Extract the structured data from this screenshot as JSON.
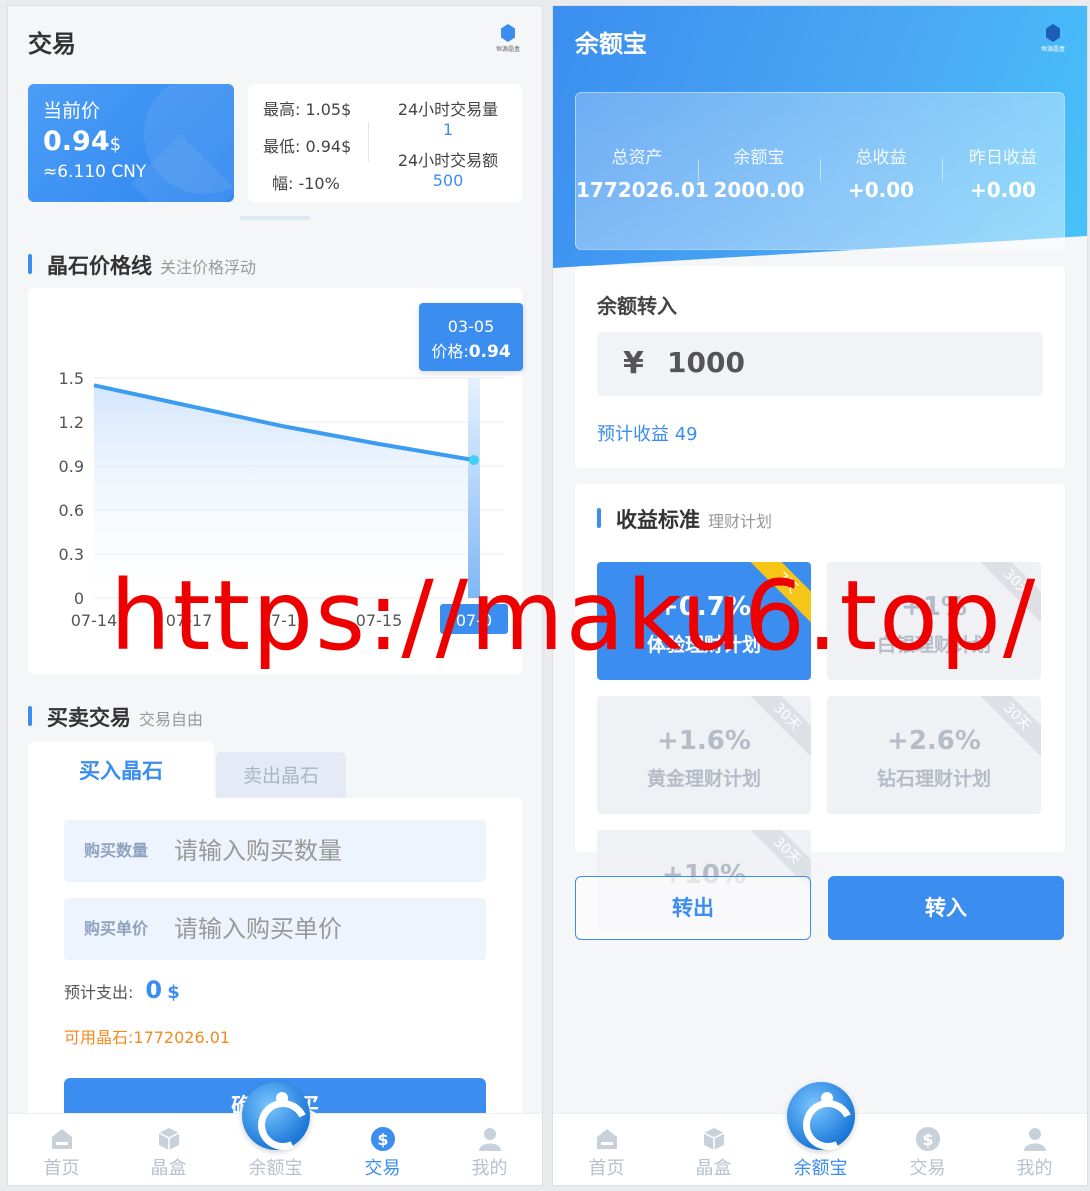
{
  "left": {
    "title": "交易",
    "logo_text": "恒源晶盒",
    "price_card": {
      "label": "当前价",
      "value": "0.94",
      "currency": "$",
      "cny": "≈6.110 CNY"
    },
    "stats": {
      "high": "最高: 1.05$",
      "low": "最低: 0.94$",
      "change": "幅: -10%",
      "volume_label": "24小时交易量",
      "volume_value": "1",
      "amount_label": "24小时交易额",
      "amount_value": "500"
    },
    "chart_section": {
      "title": "晶石价格线",
      "subtitle": "关注价格浮动"
    },
    "tooltip": {
      "date": "03-05",
      "price_label": "价格:",
      "price_value": "0.94"
    },
    "trade_section": {
      "title": "买卖交易",
      "subtitle": "交易自由"
    },
    "trade": {
      "tab_buy": "买入晶石",
      "tab_sell": "卖出晶石",
      "qty_label": "购买数量",
      "qty_placeholder": "请输入购买数量",
      "unit_label": "购买单价",
      "unit_placeholder": "请输入购买单价",
      "cost_label": "预计支出:",
      "cost_value": "0",
      "cost_currency": "$",
      "available": "可用晶石:1772026.01",
      "confirm_label": "确认购买"
    },
    "tabbar": [
      {
        "label": "首页",
        "icon": "home-icon"
      },
      {
        "label": "晶盒",
        "icon": "cube-icon"
      },
      {
        "label": "余额宝",
        "icon": "logo-icon"
      },
      {
        "label": "交易",
        "icon": "dollar-icon"
      },
      {
        "label": "我的",
        "icon": "user-icon"
      }
    ],
    "active_tab": 3
  },
  "chart_data": {
    "type": "area",
    "categories": [
      "07-14",
      "07-17",
      "07-12",
      "07-15",
      "07-0"
    ],
    "series": [
      {
        "values": [
          1.45,
          1.31,
          1.17,
          1.05,
          0.94
        ]
      }
    ],
    "y_ticks": [
      "0",
      "0.3",
      "0.6",
      "0.9",
      "1.2",
      "1.5"
    ],
    "ylim": [
      0,
      1.5
    ],
    "grid": true,
    "color": "#3b9cf0"
  },
  "right": {
    "title": "余额宝",
    "logo_text": "恒源晶盒",
    "assets": [
      {
        "label": "总资产",
        "value": "1772026.01"
      },
      {
        "label": "余额宝",
        "value": "2000.00"
      },
      {
        "label": "总收益",
        "value": "+0.00"
      },
      {
        "label": "昨日收益",
        "value": "+0.00"
      }
    ],
    "transfer": {
      "title": "余额转入",
      "currency": "¥",
      "amount": "1000",
      "estimate": "预计收益 49"
    },
    "plans_section": {
      "title": "收益标准",
      "subtitle": "理财计划"
    },
    "plans": [
      {
        "rate": "+0.7%",
        "name": "体验理财计划",
        "days": "7天",
        "active": true
      },
      {
        "rate": "+1%",
        "name": "白银理财计划",
        "days": "30天",
        "active": false
      },
      {
        "rate": "+1.6%",
        "name": "黄金理财计划",
        "days": "30天",
        "active": false
      },
      {
        "rate": "+2.6%",
        "name": "钻石理财计划",
        "days": "30天",
        "active": false
      },
      {
        "rate": "+10%",
        "name": "",
        "days": "30天",
        "active": false
      }
    ],
    "buttons": {
      "out": "转出",
      "in": "转入"
    },
    "tabbar": [
      {
        "label": "首页",
        "icon": "home-icon"
      },
      {
        "label": "晶盒",
        "icon": "cube-icon"
      },
      {
        "label": "余额宝",
        "icon": "logo-icon"
      },
      {
        "label": "交易",
        "icon": "dollar-icon"
      },
      {
        "label": "我的",
        "icon": "user-icon"
      }
    ],
    "active_tab": 2
  },
  "watermark": "https://maku6.top/",
  "colors": {
    "primary": "#3b8ef0",
    "orange": "#f08b22",
    "gold": "#f5c518"
  }
}
